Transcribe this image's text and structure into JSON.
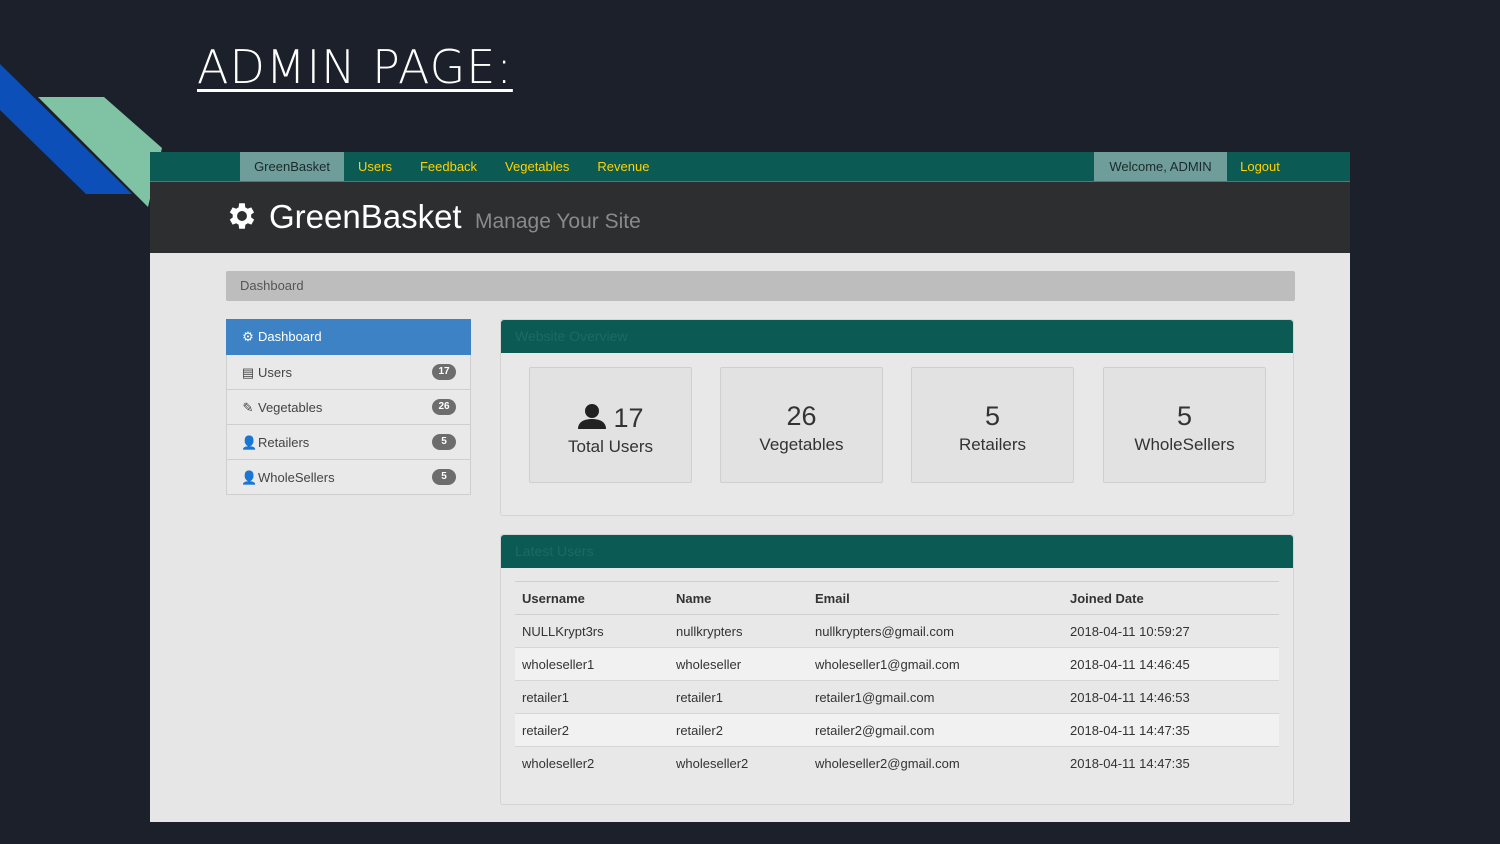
{
  "slide": {
    "title": "ADMIN PAGE:"
  },
  "topnav": {
    "brand": "GreenBasket",
    "menu": [
      "Users",
      "Feedback",
      "Vegetables",
      "Revenue"
    ],
    "welcome": "Welcome, ADMIN",
    "logout": "Logout"
  },
  "header": {
    "site_name": "GreenBasket",
    "tagline": "Manage Your Site"
  },
  "breadcrumb": "Dashboard",
  "sidebar": {
    "items": [
      {
        "label": "Dashboard",
        "icon": "gear-icon",
        "badge": ""
      },
      {
        "label": "Users",
        "icon": "list-icon",
        "badge": "17"
      },
      {
        "label": "Vegetables",
        "icon": "pencil-icon",
        "badge": "26"
      },
      {
        "label": "Retailers",
        "icon": "user-icon",
        "badge": "5"
      },
      {
        "label": "WholeSellers",
        "icon": "user-icon",
        "badge": "5"
      }
    ]
  },
  "overview": {
    "title": "Website Overview",
    "stats": [
      {
        "value": "17",
        "label": "Total Users"
      },
      {
        "value": "26",
        "label": "Vegetables"
      },
      {
        "value": "5",
        "label": "Retailers"
      },
      {
        "value": "5",
        "label": "WholeSellers"
      }
    ]
  },
  "latest_users": {
    "title": "Latest Users",
    "columns": [
      "Username",
      "Name",
      "Email",
      "Joined Date"
    ],
    "rows": [
      [
        "NULLKrypt3rs",
        "nullkrypters",
        "nullkrypters@gmail.com",
        "2018-04-11 10:59:27"
      ],
      [
        "wholeseller1",
        "wholeseller",
        "wholeseller1@gmail.com",
        "2018-04-11 14:46:45"
      ],
      [
        "retailer1",
        "retailer1",
        "retailer1@gmail.com",
        "2018-04-11 14:46:53"
      ],
      [
        "retailer2",
        "retailer2",
        "retailer2@gmail.com",
        "2018-04-11 14:47:35"
      ],
      [
        "wholeseller2",
        "wholeseller2",
        "wholeseller2@gmail.com",
        "2018-04-11 14:47:35"
      ]
    ]
  },
  "colors": {
    "nav": "#0b5a53",
    "accent_text": "#ffd200",
    "active_item": "#3d82c4",
    "background": "#1c202b"
  }
}
